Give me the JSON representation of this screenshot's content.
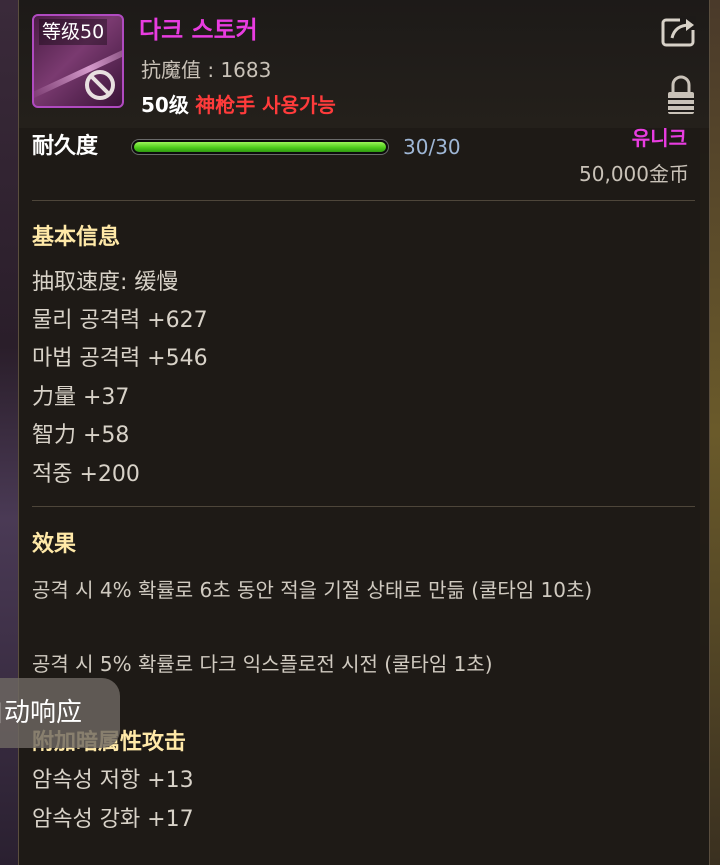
{
  "item": {
    "level_badge": "等级50",
    "name": "다크 스토커",
    "resist_label": "抗魔值 : 1683",
    "req_level": "50级",
    "req_class": "神枪手 사용가능",
    "rarity": "유니크",
    "price": "50,000金币"
  },
  "durability": {
    "label": "耐久度",
    "value_text": "30/30",
    "fraction": 1.0
  },
  "basic_info": {
    "title": "基本信息",
    "stats": [
      "抽取速度:  缓慢",
      "물리 공격력 +627",
      "마법 공격력 +546",
      "力量 +37",
      "智力 +58",
      "적중 +200"
    ]
  },
  "effects": {
    "title": "效果",
    "lines": [
      "공격 시 4% 확률로 6초 동안 적을 기절 상태로 만듦 (쿨타임 10초)",
      "공격 시 5% 확률로 다크 익스플로전 시전 (쿨타임 1초)"
    ]
  },
  "attributes": {
    "title": "附加暗属性攻击",
    "lines": [
      "암속성 저항 +13",
      "암속성 강화 +17"
    ]
  },
  "toast": {
    "text": "自动响应"
  },
  "icons": {
    "export": "export-icon",
    "lock": "lock-icon",
    "unusable": "prohibited-icon"
  },
  "colors": {
    "unique": "#e83ce0",
    "class_req": "#ff3b3b",
    "section_title": "#ffe9a8",
    "durability_bar": "#4fce1c"
  }
}
